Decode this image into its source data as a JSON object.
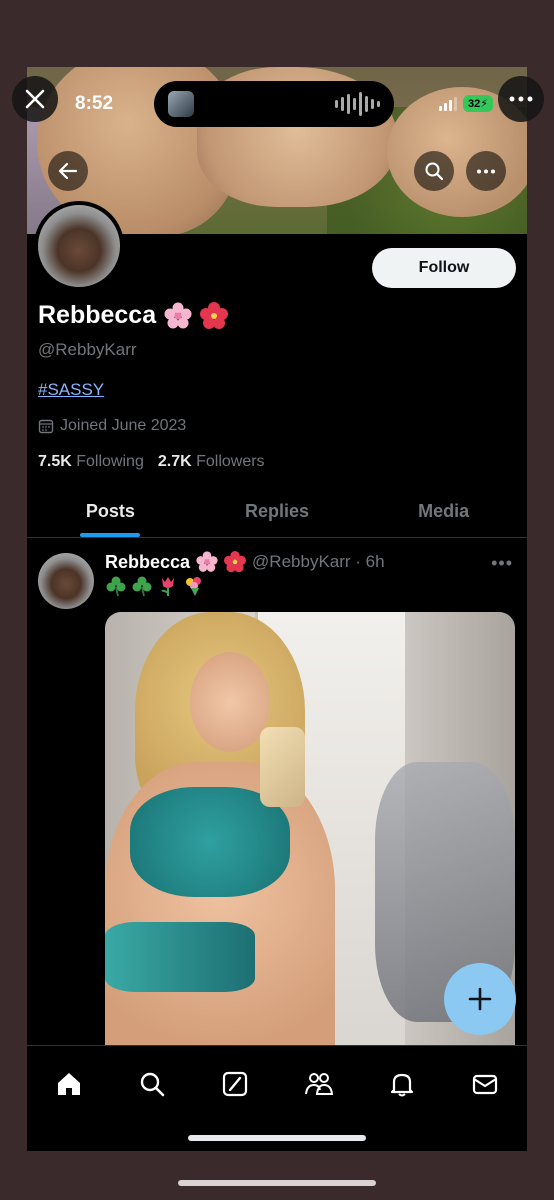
{
  "status_bar": {
    "time": "8:52",
    "battery": "32"
  },
  "profile": {
    "display_name": "Rebbecca",
    "handle": "@RebbyKarr",
    "bio_hashtag": "#SASSY",
    "joined": "Joined June 2023",
    "following_count": "7.5K",
    "following_label": "Following",
    "followers_count": "2.7K",
    "followers_label": "Followers",
    "follow_button": "Follow",
    "name_emojis": [
      "cherry-blossom",
      "hibiscus"
    ]
  },
  "tabs": [
    {
      "label": "Posts",
      "active": true
    },
    {
      "label": "Replies",
      "active": false
    },
    {
      "label": "Media",
      "active": false
    }
  ],
  "post": {
    "author": "Rebbecca",
    "handle_time": "@RebbyKarr · 6h",
    "content_emojis": [
      "shamrock",
      "shamrock",
      "tulip",
      "blossom-bouquet"
    ]
  },
  "bottom_nav": [
    "home-icon",
    "search-icon",
    "grok-icon",
    "communities-icon",
    "notifications-icon",
    "messages-icon"
  ],
  "colors": {
    "accent": "#1d9bf0",
    "fab": "#8bc8f2",
    "link": "#8ab4ff",
    "secondary_text": "#71767b",
    "background": "#000000"
  }
}
